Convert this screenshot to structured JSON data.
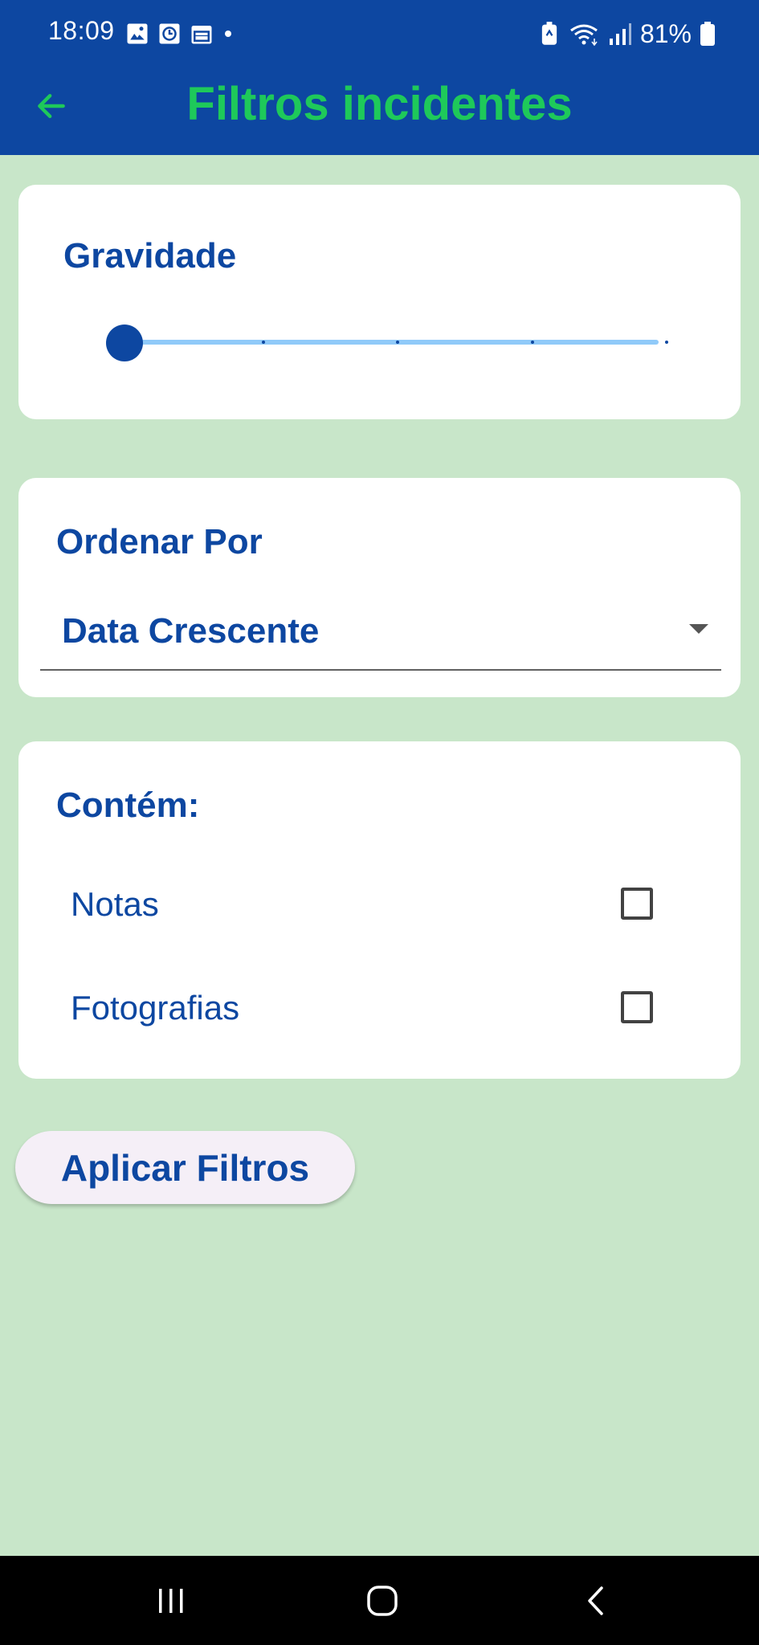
{
  "status_bar": {
    "time": "18:09",
    "battery": "81%",
    "left_icons": [
      "gallery-icon",
      "clock-icon",
      "calendar-icon",
      "dot-icon"
    ],
    "right_icons": [
      "battery-saver-icon",
      "wifi-icon",
      "signal-icon",
      "battery-icon"
    ]
  },
  "app_bar": {
    "title": "Filtros incidentes",
    "back_icon": "arrow-left-icon"
  },
  "gravity": {
    "title": "Gravidade",
    "slider_value_fraction": 0,
    "slider_divisions": 4
  },
  "order": {
    "title": "Ordenar Por",
    "selected": "Data Crescente"
  },
  "contains": {
    "title": "Contém:",
    "options": [
      {
        "label": "Notas",
        "checked": false
      },
      {
        "label": "Fotografias",
        "checked": false
      }
    ]
  },
  "apply_button": {
    "label": "Aplicar Filtros"
  },
  "nav_bar": {
    "buttons": [
      "recent-apps-icon",
      "home-icon",
      "back-icon"
    ]
  },
  "colors": {
    "header": "#0d47a1",
    "title_green": "#1ec95a",
    "background": "#c8e6c9",
    "primary_text": "#0d47a1"
  }
}
